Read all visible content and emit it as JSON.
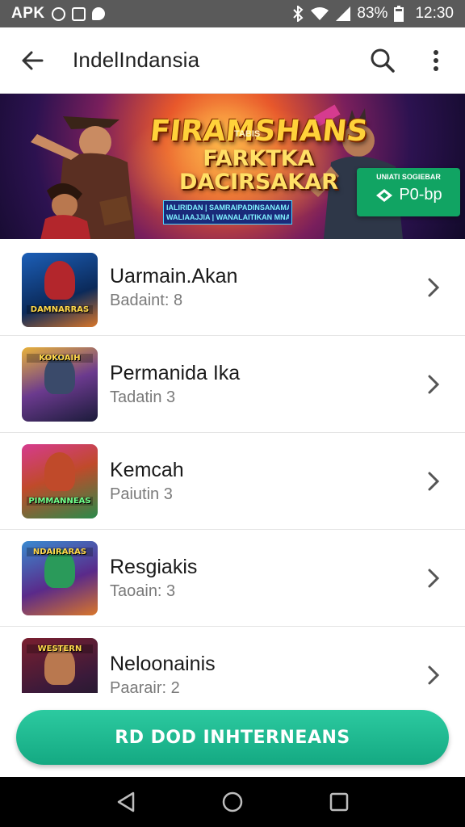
{
  "status_bar": {
    "carrier": "APK",
    "battery": "83%",
    "time": "12:30",
    "icons": [
      "circle-notification-icon",
      "square-notification-icon",
      "record-notification-icon",
      "bluetooth-icon",
      "wifi-icon",
      "signal-icon"
    ]
  },
  "app_bar": {
    "title": "IndelIndansia",
    "back_icon": "arrow-back-icon",
    "search_icon": "search-icon",
    "more_icon": "more-vert-icon"
  },
  "banner": {
    "title_line1": "FIRAMSHANS",
    "small_tag": "TABIS",
    "title_line2a": "FARKTKA",
    "title_line2b": "DACIRSAKAR",
    "strip_line1": "IALIRIDAN | SAMRAIPADINSANAMA",
    "strip_line2": "WALIAAJJIA | WANALAITIKAN MNA",
    "cta_small": "UNIATI SOGIEBAR",
    "cta_label": "P0-bp",
    "colors": {
      "cta": "#11a463",
      "title": "#ffd23a"
    }
  },
  "list": {
    "items": [
      {
        "title": "Uarmain.Akan",
        "subtitle": "Badaint: 8",
        "thumb_label": "DAMNARRAS",
        "thumb_color": "#1c5fb8"
      },
      {
        "title": "Permanida Ika",
        "subtitle": "Tadatin 3",
        "thumb_label": "KOKOAIH",
        "thumb_color": "#6b3a8e"
      },
      {
        "title": "Kemcah",
        "subtitle": "Paiutin 3",
        "thumb_label": "PIMMANNEAS",
        "thumb_color": "#c04a2a"
      },
      {
        "title": "Resgiakis",
        "subtitle": "Taoain: 3",
        "thumb_label": "NDAIRARAS",
        "thumb_color": "#3a8ad0"
      },
      {
        "title": "Neloonainis",
        "subtitle": "Paarair: 2",
        "thumb_label": "WESTERN",
        "thumb_color": "#7a1f2f"
      }
    ],
    "chevron_icon": "chevron-right-icon"
  },
  "bottom_cta": {
    "label": "RD DOD INHTERNEANS",
    "color": "#1dbb8f"
  },
  "nav_bar": {
    "icons": [
      "back-triangle-icon",
      "home-circle-icon",
      "recents-square-icon"
    ]
  }
}
